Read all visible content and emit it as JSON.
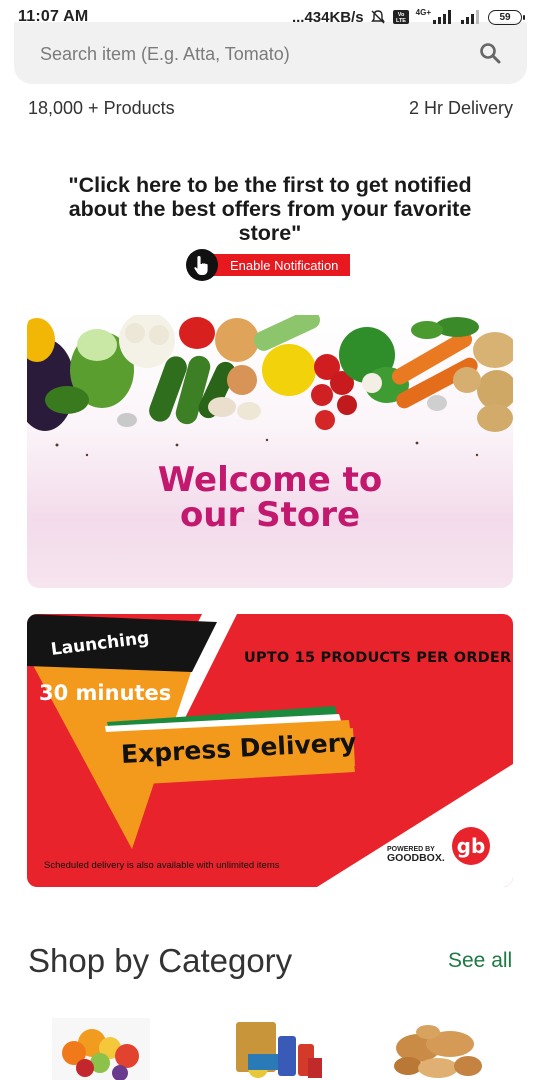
{
  "status_bar": {
    "time": "11:07 AM",
    "network_speed": "...434KB/s",
    "network_type": "4G+",
    "battery": "59"
  },
  "search": {
    "placeholder": "Search item (E.g. Atta, Tomato)"
  },
  "info": {
    "products": "18,000 + Products",
    "delivery": "2 Hr Delivery"
  },
  "notification": {
    "prompt": "\"Click here to be the first to get notified about the best offers from your favorite store\"",
    "button_label": "Enable Notification"
  },
  "welcome_banner": {
    "line1": "Welcome to",
    "line2": "our Store"
  },
  "express_banner": {
    "launching": "Launching",
    "thirty_minutes": "30 minutes",
    "upto": "UPTO 15 PRODUCTS PER ORDER",
    "express": "Express Delivery",
    "scheduled": "Scheduled delivery is also available with unlimited items",
    "powered_by": "POWERED BY",
    "brand": "GOODBOX.",
    "logo": "gb"
  },
  "category": {
    "title": "Shop by Category",
    "see_all": "See all",
    "items": [
      {
        "icon": "fruits-icon"
      },
      {
        "icon": "grocery-icon"
      },
      {
        "icon": "bakery-icon"
      }
    ]
  },
  "colors": {
    "accent_red": "#e8232b",
    "welcome_magenta": "#c2186e",
    "see_all_green": "#1e7a44"
  }
}
